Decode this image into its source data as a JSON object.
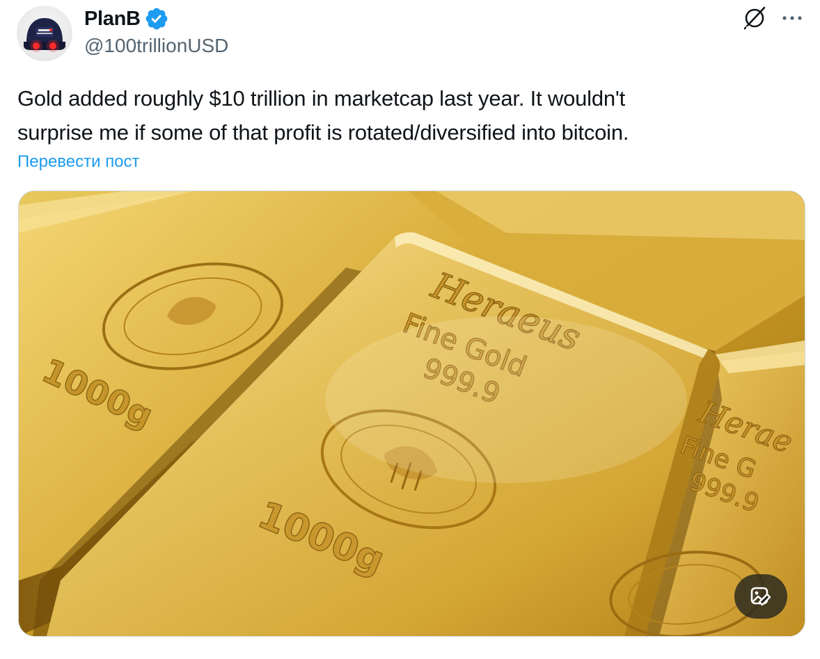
{
  "author": {
    "display_name": "PlanB",
    "handle": "@100trillionUSD",
    "avatar_icon": "planb-cap-avatar",
    "verified": true,
    "verified_color": "#1d9bf0"
  },
  "tweet": {
    "text_line_1": "Gold added roughly $10 trillion in marketcap last year. It wouldn't",
    "text_line_2": "surprise me if some of that profit is rotated/diversified into bitcoin.",
    "translate_label": "Перевести пост"
  },
  "header_actions": {
    "grok_icon": "grok-icon",
    "more_icon": "more-icon"
  },
  "media": {
    "image_icon": "gold-bars-photo",
    "action_icon": "image-edit-icon",
    "bar_front": {
      "brand": "Heraeus",
      "line1": "Fine Gold",
      "line2": "999.9",
      "weight": "1000g"
    },
    "bar_left": {
      "weight": "1000g"
    },
    "bar_right": {
      "brand": "Herae",
      "line1": "Fine G",
      "line2": "999.9"
    },
    "colors": {
      "gold_light": "#f7dc7a",
      "gold_mid": "#d9a92c",
      "gold_dark": "#8a5f10"
    }
  },
  "colors": {
    "text": "#0f1419",
    "secondary": "#536471",
    "link": "#1d9bf0",
    "border": "#cfd9de"
  }
}
